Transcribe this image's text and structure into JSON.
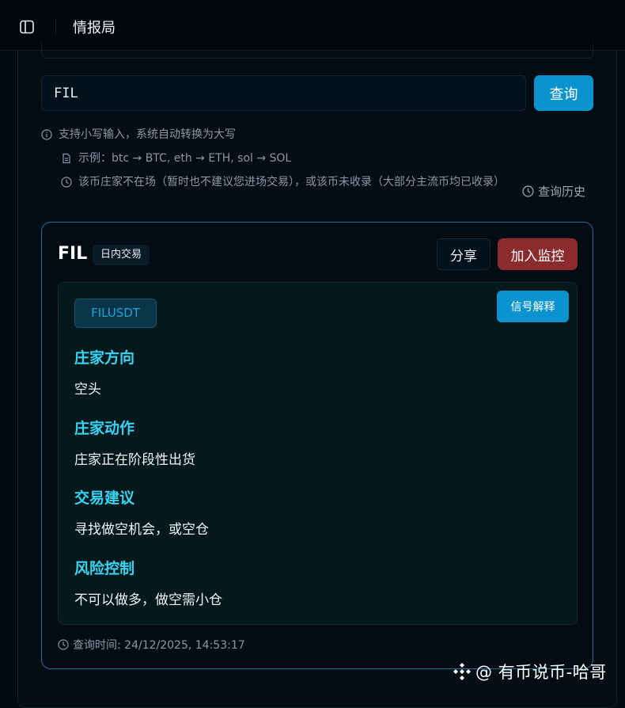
{
  "header": {
    "title": "情报局"
  },
  "search": {
    "value": "FIL",
    "button_label": "查询"
  },
  "hints": {
    "lowercase_hint": "支持小写输入，系统自动转换为大写",
    "example": "示例：btc → BTC, eth → ETH, sol → SOL",
    "notice": "该币庄家不在场（暂时也不建议您进场交易），或该币未收录（大部分主流币均已收录）",
    "history_link": "查询历史"
  },
  "result": {
    "symbol": "FIL",
    "mode_badge": "日内交易",
    "share_label": "分享",
    "monitor_label": "加入监控",
    "pair": "FILUSDT",
    "explain_label": "信号解释",
    "sections": [
      {
        "title": "庄家方向",
        "value": "空头"
      },
      {
        "title": "庄家动作",
        "value": "庄家正在阶段性出货"
      },
      {
        "title": "交易建议",
        "value": "寻找做空机会，或空仓"
      },
      {
        "title": "风险控制",
        "value": "不可以做多，做空需小仓"
      }
    ],
    "query_time": "查询时间: 24/12/2025, 14:53:17"
  },
  "watermark": "@ 有币说币-哈哥",
  "colors": {
    "accent": "#0a93cf",
    "danger": "#8c2b2e",
    "section_title": "#36d4f1",
    "card_border": "#1a6fa3"
  }
}
